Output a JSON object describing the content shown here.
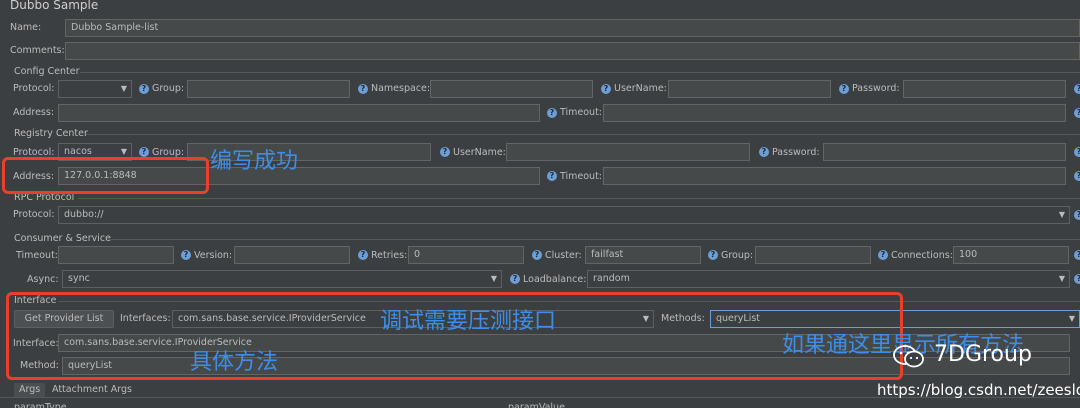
{
  "window": {
    "title": "Dubbo Sample"
  },
  "name": {
    "label": "Name:",
    "value": "Dubbo Sample-list"
  },
  "comments": {
    "label": "Comments:",
    "value": ""
  },
  "config_center": {
    "title": "Config Center",
    "protocol_label": "Protocol:",
    "protocol_value": "",
    "group_label": "Group:",
    "namespace_label": "Namespace:",
    "username_label": "UserName:",
    "password_label": "Password:",
    "address_label": "Address:",
    "timeout_label": "Timeout:"
  },
  "registry_center": {
    "title": "Registry Center",
    "protocol_label": "Protocol:",
    "protocol_value": "nacos",
    "group_label": "Group:",
    "username_label": "UserName:",
    "password_label": "Password:",
    "address_label": "Address:",
    "address_value": "127.0.0.1:8848",
    "timeout_label": "Timeout:"
  },
  "rpc_protocol": {
    "title": "RPC Protocol",
    "protocol_label": "Protocol:",
    "protocol_value": "dubbo://"
  },
  "consumer_service": {
    "title": "Consumer & Service",
    "timeout_label": "Timeout:",
    "version_label": "Version:",
    "retries_label": "Retries:",
    "retries_value": "0",
    "cluster_label": "Cluster:",
    "cluster_value": "failfast",
    "group_label": "Group:",
    "connections_label": "Connections:",
    "connections_value": "100",
    "async_label": "Async:",
    "async_value": "sync",
    "loadbalance_label": "Loadbalance:",
    "loadbalance_value": "random"
  },
  "interface": {
    "title": "Interface",
    "get_provider_list": "Get Provider List",
    "interfaces_label": "Interfaces:",
    "interfaces_value": "com.sans.base.service.IProviderService",
    "methods_label": "Methods:",
    "methods_value": "queryList",
    "interface_label": "Interface:",
    "interface_value": "com.sans.base.service.IProviderService",
    "method_label": "Method:",
    "method_value": "queryList"
  },
  "tabs": [
    "Args",
    "Attachment Args"
  ],
  "table_headers": [
    "paramType",
    "paramValue"
  ],
  "annotations": {
    "write_success": "编写成功",
    "interface_to_test": "调试需要压测接口",
    "specific_method": "具体方法",
    "show_all_methods": "如果通这里显示所有方法"
  },
  "watermark": {
    "brand": "7DGroup",
    "url": "https://blog.csdn.net/zeeslo"
  },
  "colors": {
    "background": "#3c3f41",
    "field_bg": "#45494a",
    "annotation_box": "#e8402c",
    "annotation_text": "#3d8ee8",
    "help_icon": "#6d9fd6"
  }
}
